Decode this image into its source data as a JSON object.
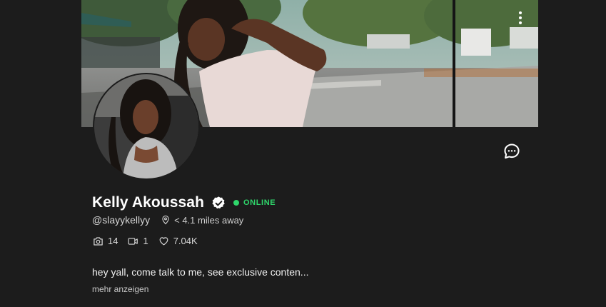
{
  "profile": {
    "display_name": "Kelly Akoussah",
    "verified_icon": "verified-check-icon",
    "status_label": "ONLINE",
    "status_color": "#2fd66b",
    "handle": "@slayykellyy",
    "distance": "< 4.1 miles away",
    "bio": "hey yall, come talk to me, see exclusive conten...",
    "show_more_label": "mehr anzeigen"
  },
  "stats": {
    "photos": "14",
    "videos": "1",
    "likes": "7.04K"
  },
  "icons": {
    "cover_menu": "more-vertical-icon",
    "chat": "chat-bubble-icon",
    "location": "location-pin-icon",
    "photos": "camera-icon",
    "videos": "video-camera-icon",
    "likes": "heart-icon"
  },
  "colors": {
    "background": "#1c1c1c",
    "text_primary": "#ffffff",
    "text_secondary": "#d6d6d6"
  }
}
